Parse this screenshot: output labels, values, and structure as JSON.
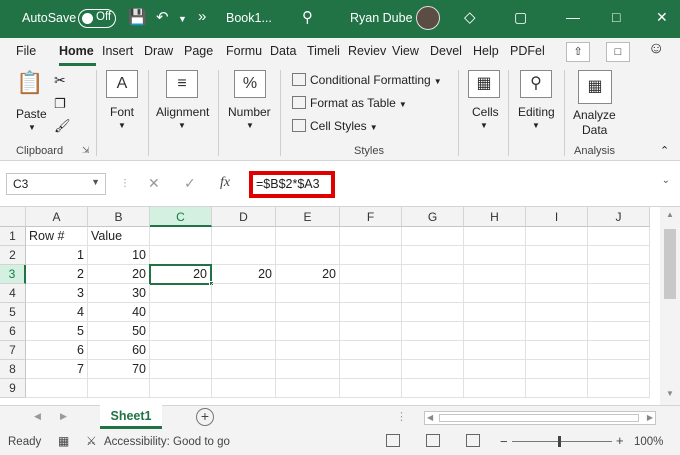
{
  "titlebar": {
    "autosave": "AutoSave",
    "toggle_state": "Off",
    "overflow": "»",
    "doc_title": "Book1...",
    "user_name": "Ryan Dube"
  },
  "tabs": [
    "File",
    "Home",
    "Insert",
    "Draw",
    "Page",
    "Formu",
    "Data",
    "Timeli",
    "Reviev",
    "View",
    "Devel",
    "Help",
    "PDFel"
  ],
  "active_tab": "Home",
  "ribbon": {
    "paste": "Paste",
    "clipboard": "Clipboard",
    "font": "Font",
    "alignment": "Alignment",
    "number": "Number",
    "number_icon": "%",
    "conditional_formatting": "Conditional Formatting",
    "format_as_table": "Format as Table",
    "cell_styles": "Cell Styles",
    "styles": "Styles",
    "cells": "Cells",
    "editing": "Editing",
    "analyze_data_1": "Analyze",
    "analyze_data_2": "Data",
    "analysis": "Analysis"
  },
  "formula_bar": {
    "name_box": "C3",
    "fx": "fx",
    "formula": "=$B$2*$A3"
  },
  "columns": [
    "A",
    "B",
    "C",
    "D",
    "E",
    "F",
    "G",
    "H",
    "I",
    "J"
  ],
  "selected_column": "C",
  "rows": [
    {
      "num": "1",
      "cells": [
        "Row #",
        "Value",
        "",
        "",
        "",
        "",
        "",
        "",
        "",
        ""
      ]
    },
    {
      "num": "2",
      "cells": [
        "1",
        "10",
        "",
        "",
        "",
        "",
        "",
        "",
        "",
        ""
      ]
    },
    {
      "num": "3",
      "cells": [
        "2",
        "20",
        "20",
        "20",
        "20",
        "",
        "",
        "",
        "",
        ""
      ]
    },
    {
      "num": "4",
      "cells": [
        "3",
        "30",
        "",
        "",
        "",
        "",
        "",
        "",
        "",
        ""
      ]
    },
    {
      "num": "5",
      "cells": [
        "4",
        "40",
        "",
        "",
        "",
        "",
        "",
        "",
        "",
        ""
      ]
    },
    {
      "num": "6",
      "cells": [
        "5",
        "50",
        "",
        "",
        "",
        "",
        "",
        "",
        "",
        ""
      ]
    },
    {
      "num": "7",
      "cells": [
        "6",
        "60",
        "",
        "",
        "",
        "",
        "",
        "",
        "",
        ""
      ]
    },
    {
      "num": "8",
      "cells": [
        "7",
        "70",
        "",
        "",
        "",
        "",
        "",
        "",
        "",
        ""
      ]
    },
    {
      "num": "9",
      "cells": [
        "",
        "",
        "",
        "",
        "",
        "",
        "",
        "",
        "",
        ""
      ]
    }
  ],
  "selected_row": "3",
  "sheet": {
    "tab": "Sheet1",
    "add": "+"
  },
  "status": {
    "ready": "Ready",
    "accessibility": "Accessibility: Good to go",
    "zoom_minus": "−",
    "zoom_plus": "+",
    "zoom": "100%"
  },
  "colors": {
    "brand": "#217346",
    "highlight": "#e00000"
  }
}
